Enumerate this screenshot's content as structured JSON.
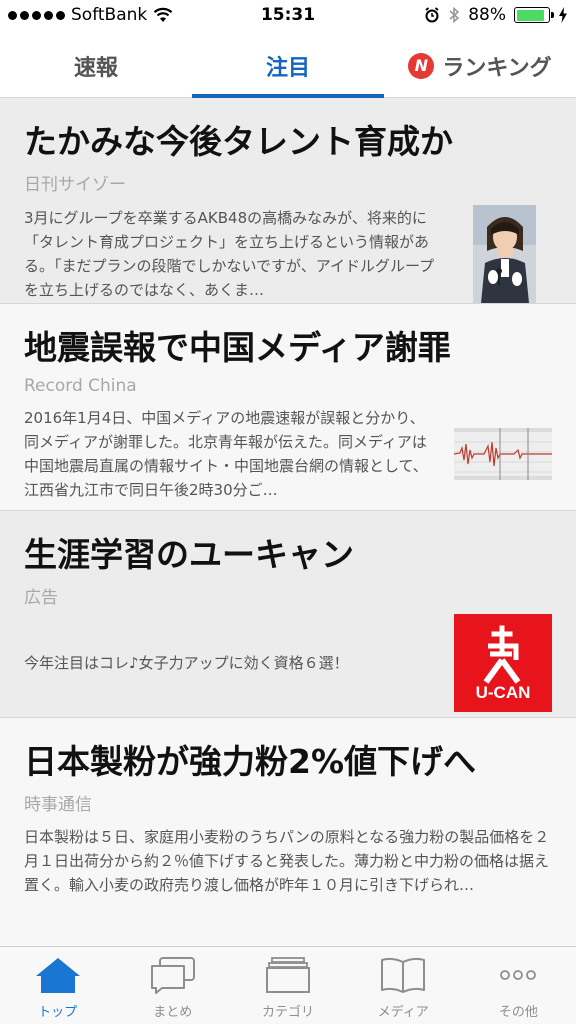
{
  "status_bar": {
    "carrier": "SoftBank",
    "time": "15:31",
    "battery": "88%",
    "battery_level": 0.88
  },
  "top_tabs": [
    {
      "label": "速報",
      "active": false
    },
    {
      "label": "注目",
      "active": true
    },
    {
      "label": "ランキング",
      "active": false,
      "badge": "N"
    }
  ],
  "articles": [
    {
      "headline": "たかみな今後タレント育成か",
      "source": "日刊サイゾー",
      "excerpt": "3月にグループを卒業するAKB48の高橋みなみが、将来的に「タレント育成プロジェクト」を立ち上げるという情報がある。「まだプランの段階でしかないですが、アイドルグループを立ち上げるのではなく、あくま…"
    },
    {
      "headline": "地震誤報で中国メディア謝罪",
      "source": "Record China",
      "excerpt": "2016年1月4日、中国メディアの地震速報が誤報と分かり、同メディアが謝罪した。北京青年報が伝えた。同メディアは中国地震局直属の情報サイト・中国地震台網の情報として、江西省九江市で同日午後2時30分ご…"
    },
    {
      "headline": "生涯学習のユーキャン",
      "source": "広告",
      "excerpt": "今年注目はコレ♪女子力アップに効く資格６選！",
      "logo_text": "U-CAN"
    },
    {
      "headline": "日本製粉が強力粉2%値下げへ",
      "source": "時事通信",
      "excerpt": "日本製粉は５日、家庭用小麦粉のうちパンの原料となる強力粉の製品価格を２月１日出荷分から約２％値下げすると発表した。薄力粉と中力粉の価格は据え置く。輸入小麦の政府売り渡し価格が昨年１０月に引き下げられ…"
    }
  ],
  "bottom_nav": [
    {
      "label": "トップ",
      "icon": "home-icon",
      "active": true
    },
    {
      "label": "まとめ",
      "icon": "chat-bubbles-icon",
      "active": false
    },
    {
      "label": "カテゴリ",
      "icon": "stacked-folders-icon",
      "active": false
    },
    {
      "label": "メディア",
      "icon": "open-book-icon",
      "active": false
    },
    {
      "label": "その他",
      "icon": "more-dots-icon",
      "active": false
    }
  ],
  "colors": {
    "accent": "#1565c0",
    "ranking_badge": "#e53935",
    "ucan_red": "#e8141b",
    "battery_green": "#4cd964"
  }
}
